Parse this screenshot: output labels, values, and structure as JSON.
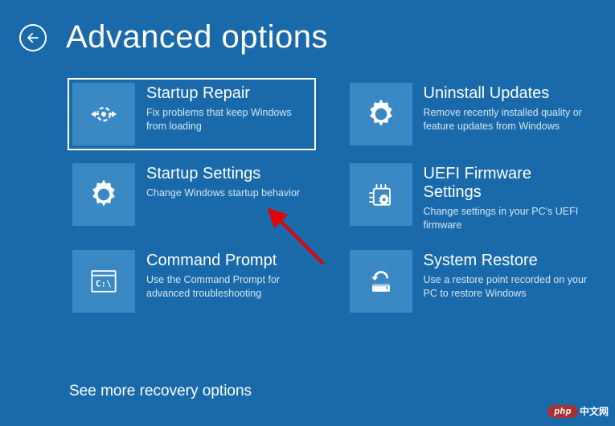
{
  "header": {
    "title": "Advanced options"
  },
  "tiles": [
    {
      "title": "Startup Repair",
      "desc": "Fix problems that keep Windows from loading"
    },
    {
      "title": "Uninstall Updates",
      "desc": "Remove recently installed quality or feature updates from Windows"
    },
    {
      "title": "Startup Settings",
      "desc": "Change Windows startup behavior"
    },
    {
      "title": "UEFI Firmware Settings",
      "desc": "Change settings in your PC's UEFI firmware"
    },
    {
      "title": "Command Prompt",
      "desc": "Use the Command Prompt for advanced troubleshooting"
    },
    {
      "title": "System Restore",
      "desc": "Use a restore point recorded on your PC to restore Windows"
    }
  ],
  "moreLink": "See more recovery options",
  "watermark": {
    "pill": "php",
    "text": "中文网"
  }
}
